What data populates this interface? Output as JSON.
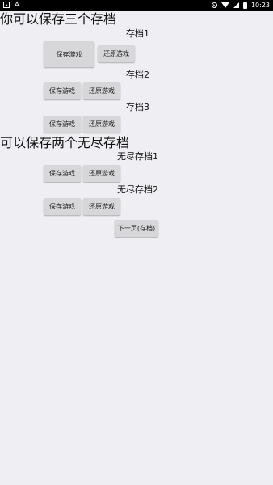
{
  "status_bar": {
    "time": "10:23",
    "left_icons": [
      "image-icon",
      "a-notification-icon"
    ],
    "right_icons": [
      "no-disturb-icon",
      "wifi-icon",
      "signal-icon",
      "battery-icon"
    ]
  },
  "section1": {
    "title": "你可以保存三个存档",
    "slots": [
      {
        "label": "存档1",
        "save_label": "保存游戏",
        "restore_label": "还原游戏"
      },
      {
        "label": "存档2",
        "save_label": "保存游戏",
        "restore_label": "还原游戏"
      },
      {
        "label": "存档3",
        "save_label": "保存游戏",
        "restore_label": "还原游戏"
      }
    ]
  },
  "section2": {
    "title": "可以保存两个无尽存档",
    "slots": [
      {
        "label": "无尽存档1",
        "save_label": "保存游戏",
        "restore_label": "还原游戏"
      },
      {
        "label": "无尽存档2",
        "save_label": "保存游戏",
        "restore_label": "还原游戏"
      }
    ]
  },
  "next_page_label": "下一页(存档)",
  "colors": {
    "background": "#efeef3",
    "button": "#d7d7d9",
    "status_bar": "#000000"
  }
}
